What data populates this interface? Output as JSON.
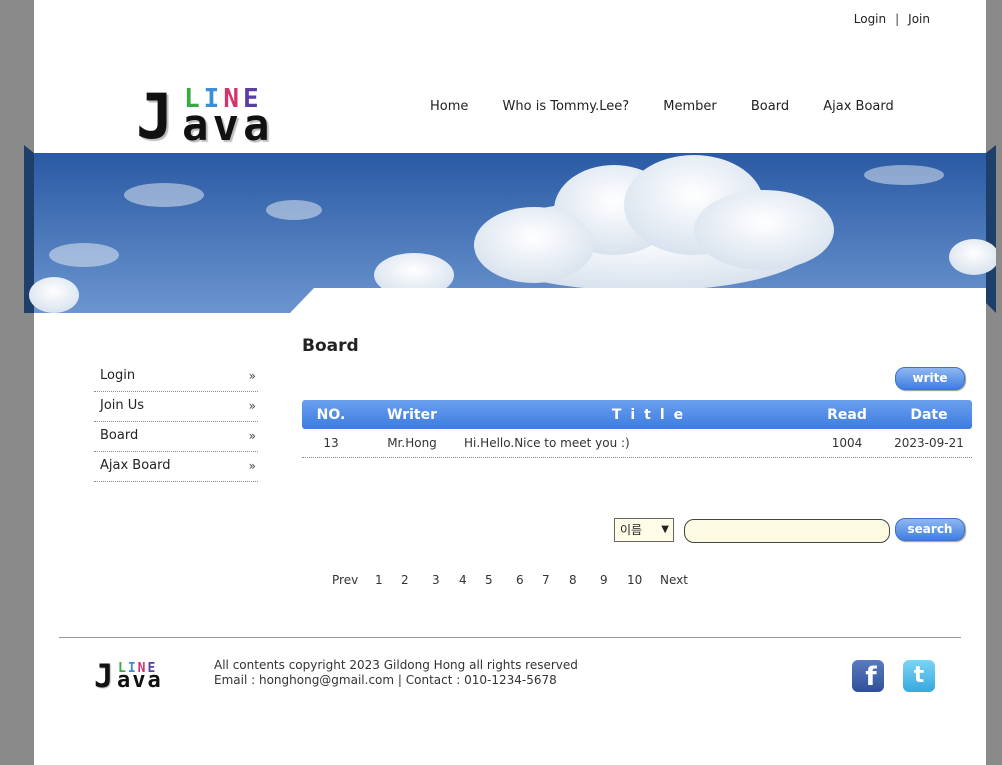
{
  "header": {
    "login_label": "Login",
    "separator": "|",
    "join_label": "Join",
    "logo": {
      "line": [
        "L",
        "I",
        "N",
        "E"
      ],
      "j": "J",
      "ava": "ava"
    },
    "nav": [
      "Home",
      "Who is Tommy.Lee?",
      "Member",
      "Board",
      "Ajax Board"
    ]
  },
  "colors": {
    "line_letters": [
      "#3aa843",
      "#3a8fd6",
      "#d6336c",
      "#5a3ea8"
    ],
    "header_blue": "#3d7be0",
    "sky": "#2f5fa8"
  },
  "sidebar": {
    "items": [
      {
        "label": "Login",
        "arrow": "»"
      },
      {
        "label": "Join Us",
        "arrow": "»"
      },
      {
        "label": "Board",
        "arrow": "»"
      },
      {
        "label": "Ajax Board",
        "arrow": "»"
      }
    ]
  },
  "main": {
    "title": "Board",
    "write_label": "write",
    "table": {
      "headers": {
        "no": "NO.",
        "writer": "Writer",
        "title": "Title",
        "read": "Read",
        "date": "Date"
      },
      "rows": [
        {
          "no": "13",
          "writer": "Mr.Hong",
          "title": "Hi.Hello.Nice to meet you :)",
          "read": "1004",
          "date": "2023-09-21"
        }
      ]
    },
    "search": {
      "select_value": "이름",
      "input_value": "",
      "button_label": "search"
    },
    "paging": {
      "prev": "Prev",
      "pages": [
        "1",
        "2",
        "3",
        "4",
        "5",
        "6",
        "7",
        "8",
        "9",
        "10"
      ],
      "next": "Next"
    }
  },
  "footer": {
    "copyright": "All contents copyright 2023 Gildong Hong all rights reserved",
    "contact": "Email : honghong@gmail.com | Contact : 010-1234-5678",
    "social": [
      {
        "icon": "facebook-icon",
        "glyph": "f"
      },
      {
        "icon": "twitter-icon",
        "glyph": "t"
      }
    ]
  }
}
